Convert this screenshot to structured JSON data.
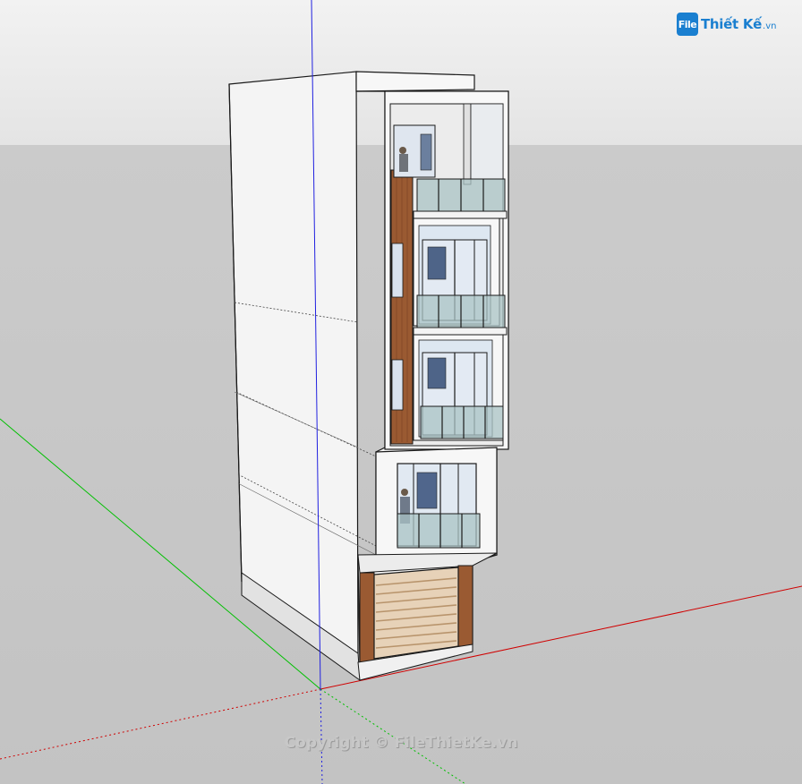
{
  "watermark": {
    "logo_box": "File",
    "logo_text": "Thiết Kế",
    "logo_tld": ".vn",
    "copyright": "Copyright © FileThietKe.vn"
  },
  "scene": {
    "model": "building-3d-model",
    "sky_color": "#e8e8e8",
    "ground_color": "#c6c6c6",
    "axis_colors": {
      "blue": "#2020e0",
      "green": "#00c000",
      "red": "#d00000"
    }
  }
}
